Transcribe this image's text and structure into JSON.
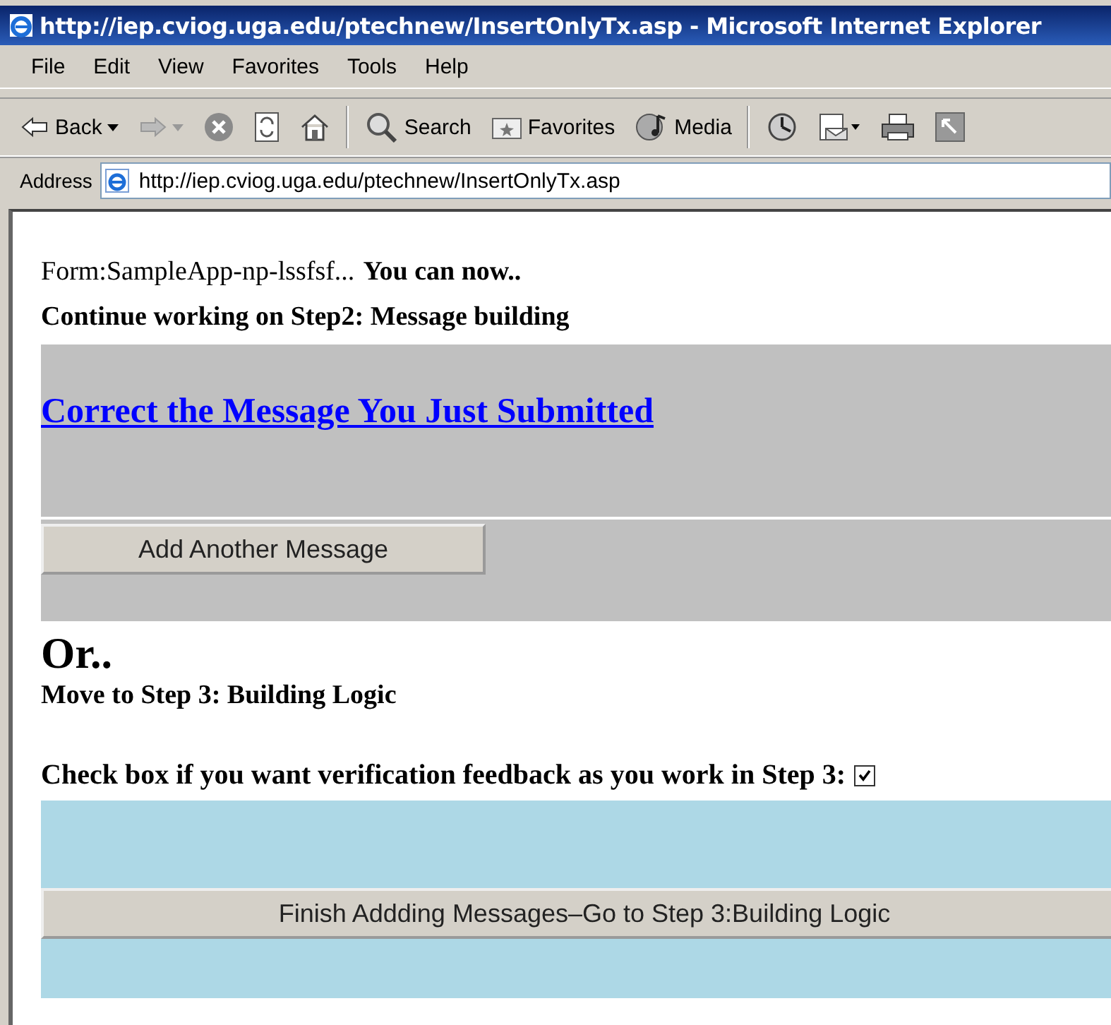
{
  "window": {
    "title": "http://iep.cviog.uga.edu/ptechnew/InsertOnlyTx.asp - Microsoft Internet Explorer"
  },
  "menu": [
    "File",
    "Edit",
    "View",
    "Favorites",
    "Tools",
    "Help"
  ],
  "toolbar": [
    {
      "kind": "back",
      "label": "Back"
    },
    {
      "kind": "forward"
    },
    {
      "kind": "stop"
    },
    {
      "kind": "refresh"
    },
    {
      "kind": "home"
    },
    {
      "kind": "search",
      "label": "Search"
    },
    {
      "kind": "favorites",
      "label": "Favorites"
    },
    {
      "kind": "media",
      "label": "Media"
    },
    {
      "kind": "history"
    },
    {
      "kind": "mail"
    },
    {
      "kind": "print"
    },
    {
      "kind": "edit"
    }
  ],
  "address": {
    "label": "Address",
    "value": "http://iep.cviog.uga.edu/ptechnew/InsertOnlyTx.asp"
  },
  "page": {
    "form_name": "Form:SampleApp-np-lssfsf...",
    "intro": "You can now..",
    "step2": "Continue working on Step2: Message building",
    "correct_link": "Correct the Message You Just Submitted",
    "add_button": "Add Another Message",
    "or": "Or..",
    "step3": "Move to Step 3: Building Logic",
    "verify": {
      "label": "Check box if you want verification feedback as you work in Step 3:",
      "checked": true
    },
    "finish_button": "Finish Addding Messages–Go to Step 3:Building Logic"
  }
}
